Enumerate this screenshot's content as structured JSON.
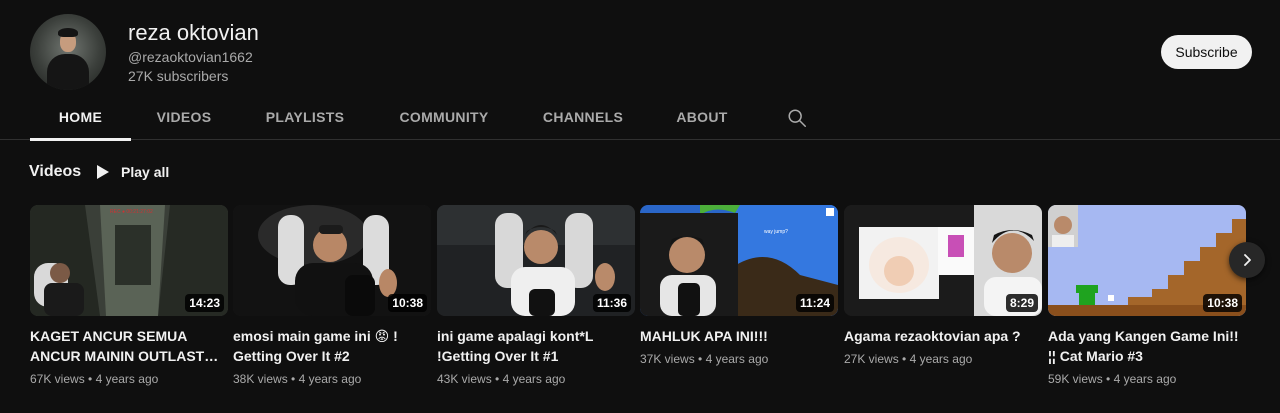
{
  "channel": {
    "name": "reza oktovian",
    "handle": "@rezaoktovian1662",
    "subscribers": "27K subscribers",
    "subscribe_label": "Subscribe"
  },
  "tabs": [
    {
      "label": "HOME",
      "active": true
    },
    {
      "label": "VIDEOS",
      "active": false
    },
    {
      "label": "PLAYLISTS",
      "active": false
    },
    {
      "label": "COMMUNITY",
      "active": false
    },
    {
      "label": "CHANNELS",
      "active": false
    },
    {
      "label": "ABOUT",
      "active": false
    }
  ],
  "section": {
    "title": "Videos",
    "play_all_label": "Play all"
  },
  "videos": [
    {
      "title": "KAGET ANCUR SEMUA ANCUR MAININ OUTLAST…",
      "duration": "14:23",
      "views": "67K views",
      "age": "4 years ago"
    },
    {
      "title": "emosi main game ini 😡 ! Getting Over It #2",
      "duration": "10:38",
      "views": "38K views",
      "age": "4 years ago"
    },
    {
      "title": "ini game apalagi kont*L !Getting Over It #1",
      "duration": "11:36",
      "views": "43K views",
      "age": "4 years ago"
    },
    {
      "title": "MAHLUK APA INI!!!",
      "duration": "11:24",
      "views": "37K views",
      "age": "4 years ago"
    },
    {
      "title": "Agama rezaoktovian apa ?",
      "duration": "8:29",
      "views": "27K views",
      "age": "4 years ago"
    },
    {
      "title": "Ada yang Kangen Game Ini!! ¦¦ Cat Mario #3",
      "duration": "10:38",
      "views": "59K views",
      "age": "4 years ago"
    }
  ],
  "icons": {
    "search": "search-icon",
    "play": "play-icon",
    "next": "chevron-right-icon"
  },
  "colors": {
    "background": "#0f0f0f",
    "text_primary": "#f1f1f1",
    "text_secondary": "#aaaaaa",
    "subscribe_bg": "#f1f1f1"
  }
}
